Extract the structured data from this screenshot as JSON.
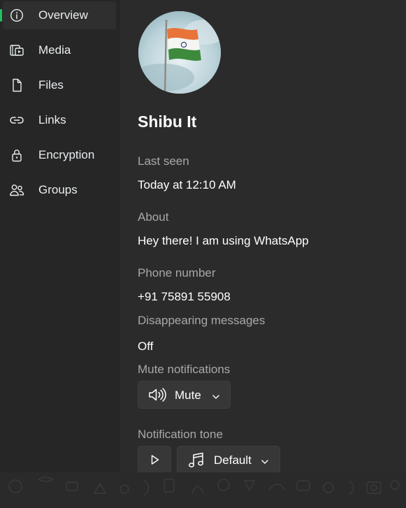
{
  "nav": {
    "items": [
      {
        "label": "Overview",
        "icon": "info-icon",
        "active": true
      },
      {
        "label": "Media",
        "icon": "media-icon"
      },
      {
        "label": "Files",
        "icon": "file-icon"
      },
      {
        "label": "Links",
        "icon": "link-icon"
      },
      {
        "label": "Encryption",
        "icon": "lock-icon"
      },
      {
        "label": "Groups",
        "icon": "people-icon"
      }
    ]
  },
  "profile": {
    "name": "Shibu It",
    "last_seen_label": "Last seen",
    "last_seen_value": "Today at 12:10 AM",
    "about_label": "About",
    "about_value": "Hey there! I am using WhatsApp",
    "phone_label": "Phone number",
    "phone_value": "+91 75891 55908",
    "disappearing_label": "Disappearing messages",
    "disappearing_value": "Off",
    "mute_label": "Mute notifications",
    "mute_button": "Mute",
    "tone_label": "Notification tone",
    "tone_button": "Default"
  },
  "colors": {
    "accent": "#21c063",
    "sidebar_bg": "#262626",
    "panel_bg": "#2b2b2b",
    "muted_text": "#a8a8a8"
  }
}
